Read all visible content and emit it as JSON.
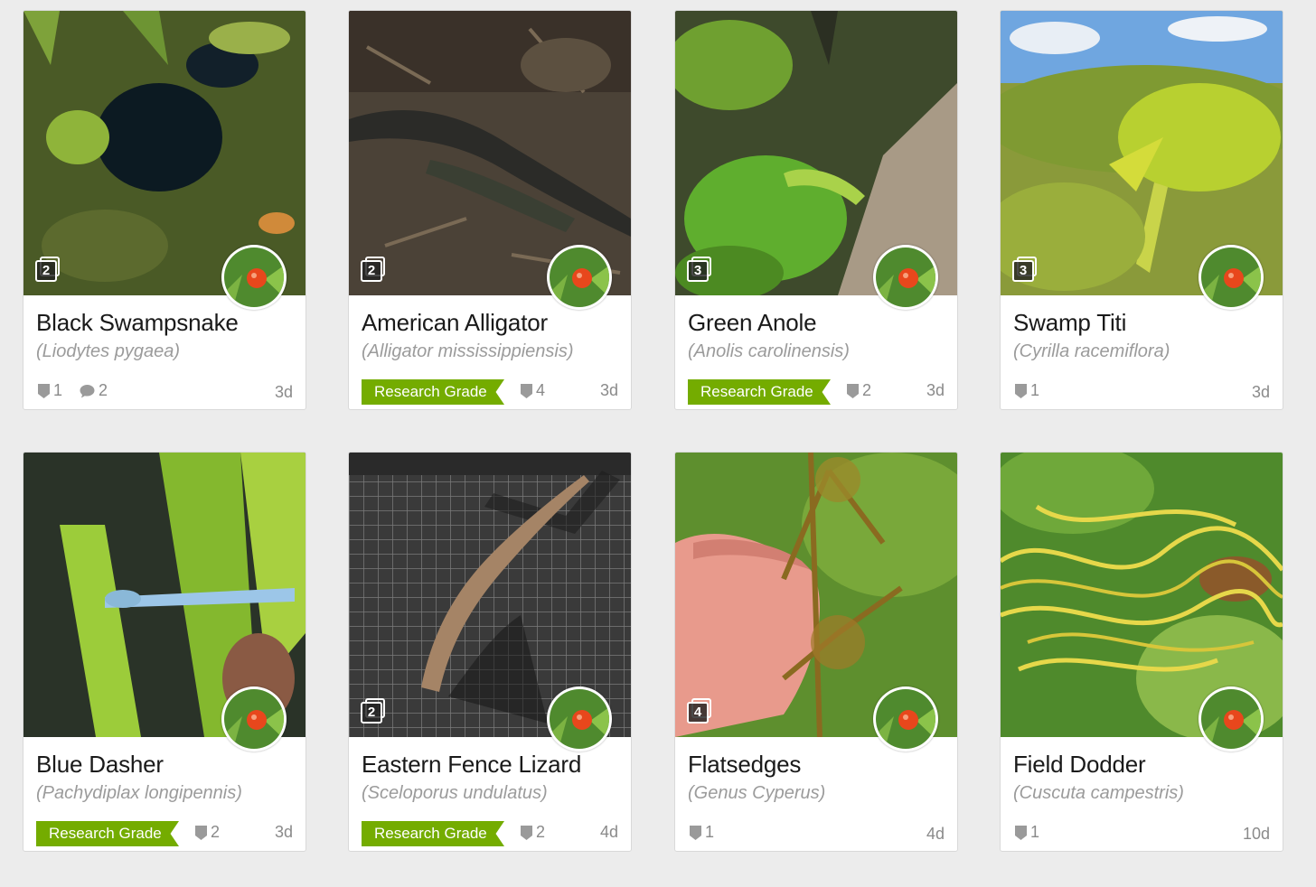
{
  "accent_color": "#74ac00",
  "observations": [
    {
      "common_name": "Black Swampsnake",
      "scientific_name": "(Liodytes pygaea)",
      "photo_count": "2",
      "research_grade": false,
      "identifications": "1",
      "comments": "2",
      "time_ago": "3d",
      "photo": "swamp-water"
    },
    {
      "common_name": "American Alligator",
      "scientific_name": "(Alligator mississippiensis)",
      "photo_count": "2",
      "research_grade": true,
      "research_label": "Research Grade",
      "identifications": "4",
      "time_ago": "3d",
      "photo": "alligator"
    },
    {
      "common_name": "Green Anole",
      "scientific_name": "(Anolis carolinensis)",
      "photo_count": "3",
      "research_grade": true,
      "research_label": "Research Grade",
      "identifications": "2",
      "time_ago": "3d",
      "photo": "anole"
    },
    {
      "common_name": "Swamp Titi",
      "scientific_name": "(Cyrilla racemiflora)",
      "photo_count": "3",
      "research_grade": false,
      "identifications": "1",
      "time_ago": "3d",
      "photo": "titi"
    },
    {
      "common_name": "Blue Dasher",
      "scientific_name": "(Pachydiplax longipennis)",
      "photo_count": "",
      "research_grade": true,
      "research_label": "Research Grade",
      "identifications": "2",
      "time_ago": "3d",
      "photo": "dasher"
    },
    {
      "common_name": "Eastern Fence Lizard",
      "scientific_name": "(Sceloporus undulatus)",
      "photo_count": "2",
      "research_grade": true,
      "research_label": "Research Grade",
      "identifications": "2",
      "time_ago": "4d",
      "photo": "lizard"
    },
    {
      "common_name": "Flatsedges",
      "scientific_name": "(Genus Cyperus)",
      "photo_count": "4",
      "research_grade": false,
      "identifications": "1",
      "time_ago": "4d",
      "photo": "sedge"
    },
    {
      "common_name": "Field Dodder",
      "scientific_name": "(Cuscuta campestris)",
      "photo_count": "",
      "research_grade": false,
      "identifications": "1",
      "time_ago": "10d",
      "photo": "dodder"
    }
  ]
}
